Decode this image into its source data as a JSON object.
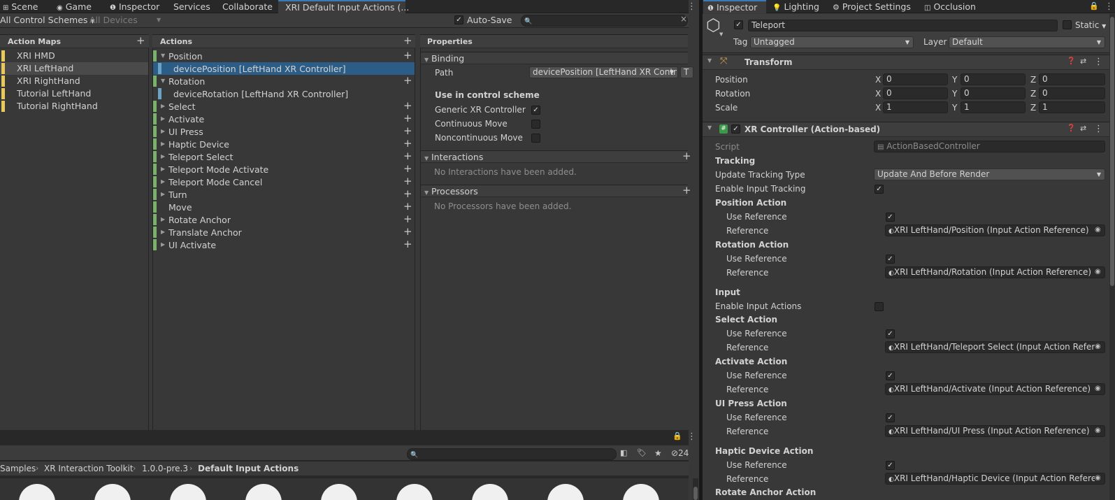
{
  "top_tabs": [
    {
      "label": "Scene",
      "icon": "grid-icon"
    },
    {
      "label": "Game",
      "icon": "gamepad-icon"
    },
    {
      "label": "Inspector",
      "icon": "info-icon"
    },
    {
      "label": "Services"
    },
    {
      "label": "Collaborate"
    },
    {
      "label": "XRI Default Input Actions (..."
    }
  ],
  "right_tabs": [
    {
      "label": "Inspector",
      "icon": "info-icon"
    },
    {
      "label": "Lighting",
      "icon": "bulb-icon"
    },
    {
      "label": "Project Settings",
      "icon": "gear-icon"
    },
    {
      "label": "Occlusion",
      "icon": "occlusion-icon"
    }
  ],
  "toolbar": {
    "control_schemes": "All Control Schemes",
    "devices": "All Devices",
    "auto_save": "Auto-Save",
    "auto_save_checked": true
  },
  "action_maps": {
    "header": "Action Maps",
    "items": [
      {
        "label": "XRI HMD",
        "selected": false
      },
      {
        "label": "XRI LeftHand",
        "selected": true
      },
      {
        "label": "XRI RightHand",
        "selected": false
      },
      {
        "label": "Tutorial LeftHand",
        "selected": false
      },
      {
        "label": "Tutorial RightHand",
        "selected": false
      }
    ]
  },
  "actions": {
    "header": "Actions",
    "items": [
      {
        "label": "Position",
        "expanded": true,
        "plus": true
      },
      {
        "label": "devicePosition [LeftHand XR Controller]",
        "binding": true,
        "selected": true
      },
      {
        "label": "Rotation",
        "expanded": true,
        "plus": true
      },
      {
        "label": "deviceRotation [LeftHand XR Controller]",
        "binding": true
      },
      {
        "label": "Select",
        "plus": true
      },
      {
        "label": "Activate",
        "plus": true
      },
      {
        "label": "UI Press",
        "plus": true
      },
      {
        "label": "Haptic Device",
        "plus": true
      },
      {
        "label": "Teleport Select",
        "plus": true
      },
      {
        "label": "Teleport Mode Activate",
        "plus": true
      },
      {
        "label": "Teleport Mode Cancel",
        "plus": true
      },
      {
        "label": "Turn",
        "plus": true
      },
      {
        "label": "Move",
        "plus": true,
        "noarrow": true
      },
      {
        "label": "Rotate Anchor",
        "plus": true
      },
      {
        "label": "Translate Anchor",
        "plus": true
      },
      {
        "label": "UI Activate",
        "plus": true
      }
    ]
  },
  "properties": {
    "header": "Properties",
    "binding_title": "Binding",
    "path_label": "Path",
    "path_value": "devicePosition [LeftHand XR Contr",
    "t_button": "T",
    "scheme_title": "Use in control scheme",
    "schemes": [
      {
        "label": "Generic XR Controller",
        "checked": true
      },
      {
        "label": "Continuous Move",
        "checked": false
      },
      {
        "label": "Noncontinuous Move",
        "checked": false
      }
    ],
    "interactions_title": "Interactions",
    "interactions_empty": "No Interactions have been added.",
    "processors_title": "Processors",
    "processors_empty": "No Processors have been added."
  },
  "project": {
    "breadcrumb": [
      "Samples",
      "XR Interaction Toolkit",
      "1.0.0-pre.3",
      "Default Input Actions"
    ],
    "hidden_count": "24"
  },
  "inspector": {
    "object_name": "Teleport",
    "active": true,
    "static_label": "Static",
    "tag_label": "Tag",
    "tag_value": "Untagged",
    "layer_label": "Layer",
    "layer_value": "Default",
    "transform": {
      "title": "Transform",
      "rows": [
        {
          "label": "Position",
          "x": "0",
          "y": "0",
          "z": "0"
        },
        {
          "label": "Rotation",
          "x": "0",
          "y": "0",
          "z": "0"
        },
        {
          "label": "Scale",
          "x": "1",
          "y": "1",
          "z": "1"
        }
      ],
      "axes": [
        "X",
        "Y",
        "Z"
      ]
    },
    "xr": {
      "title": "XR Controller (Action-based)",
      "script_label": "Script",
      "script_value": "ActionBasedController",
      "tracking": "Tracking",
      "update_tracking_label": "Update Tracking Type",
      "update_tracking_value": "Update And Before Render",
      "enable_tracking_label": "Enable Input Tracking",
      "input": "Input",
      "enable_actions_label": "Enable Input Actions",
      "use_ref": "Use Reference",
      "ref": "Reference",
      "groups": [
        {
          "title": "Position Action",
          "ref": "XRI LeftHand/Position (Input Action Reference)"
        },
        {
          "title": "Rotation Action",
          "ref": "XRI LeftHand/Rotation (Input Action Reference)"
        },
        {
          "title": "Select Action",
          "ref": "XRI LeftHand/Teleport Select (Input Action Refere"
        },
        {
          "title": "Activate Action",
          "ref": "XRI LeftHand/Activate (Input Action Reference)"
        },
        {
          "title": "UI Press Action",
          "ref": "XRI LeftHand/UI Press (Input Action Reference)"
        },
        {
          "title": "Haptic Device Action",
          "ref": "XRI LeftHand/Haptic Device (Input Action Referer"
        }
      ],
      "last_group": "Rotate Anchor Action"
    }
  },
  "colors": {
    "accent": "#2c5d87",
    "map_bar": "#e6c95a",
    "action_bar": "#7ab26b",
    "binding_bar": "#6aa4c4"
  }
}
